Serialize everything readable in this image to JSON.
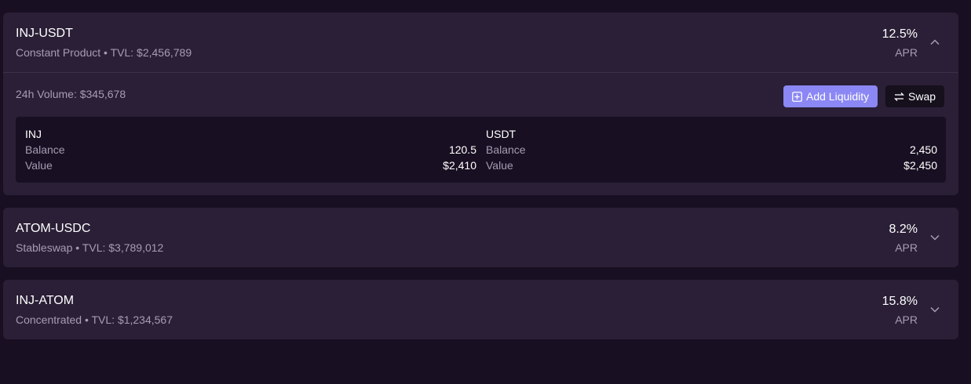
{
  "pools": [
    {
      "name": "INJ-USDT",
      "subtitle": "Constant Product • TVL: $2,456,789",
      "apr": "12.5%",
      "apr_label": "APR",
      "expanded": true,
      "volume": "24h Volume: $345,678",
      "add_liquidity_label": "Add Liquidity",
      "swap_label": "Swap",
      "tokens": [
        {
          "symbol": "INJ",
          "balance_label": "Balance",
          "balance": "120.5",
          "value_label": "Value",
          "value": "$2,410"
        },
        {
          "symbol": "USDT",
          "balance_label": "Balance",
          "balance": "2,450",
          "value_label": "Value",
          "value": "$2,450"
        }
      ]
    },
    {
      "name": "ATOM-USDC",
      "subtitle": "Stableswap • TVL: $3,789,012",
      "apr": "8.2%",
      "apr_label": "APR",
      "expanded": false
    },
    {
      "name": "INJ-ATOM",
      "subtitle": "Concentrated • TVL: $1,234,567",
      "apr": "15.8%",
      "apr_label": "APR",
      "expanded": false
    }
  ],
  "icons": {
    "expanded": "chevron-up-icon",
    "collapsed": "chevron-down-icon",
    "add": "plus-square-icon",
    "swap": "swap-arrows-icon"
  },
  "colors": {
    "background": "#181022",
    "card": "#2a1f36",
    "accent": "#8b87f4",
    "muted_text": "#a69cb3"
  }
}
